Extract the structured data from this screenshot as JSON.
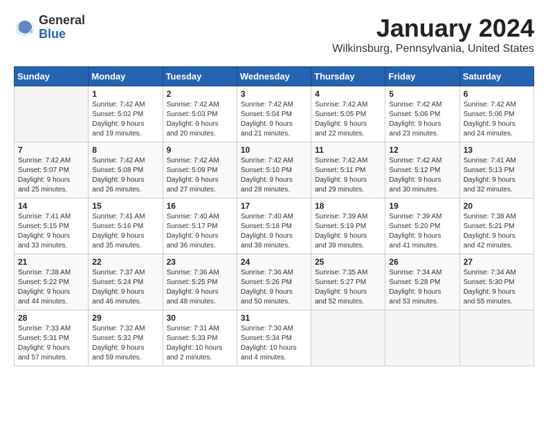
{
  "logo": {
    "general": "General",
    "blue": "Blue"
  },
  "header": {
    "month": "January 2024",
    "location": "Wilkinsburg, Pennsylvania, United States"
  },
  "weekdays": [
    "Sunday",
    "Monday",
    "Tuesday",
    "Wednesday",
    "Thursday",
    "Friday",
    "Saturday"
  ],
  "weeks": [
    [
      {
        "day": "",
        "info": ""
      },
      {
        "day": "1",
        "info": "Sunrise: 7:42 AM\nSunset: 5:02 PM\nDaylight: 9 hours\nand 19 minutes."
      },
      {
        "day": "2",
        "info": "Sunrise: 7:42 AM\nSunset: 5:03 PM\nDaylight: 9 hours\nand 20 minutes."
      },
      {
        "day": "3",
        "info": "Sunrise: 7:42 AM\nSunset: 5:04 PM\nDaylight: 9 hours\nand 21 minutes."
      },
      {
        "day": "4",
        "info": "Sunrise: 7:42 AM\nSunset: 5:05 PM\nDaylight: 9 hours\nand 22 minutes."
      },
      {
        "day": "5",
        "info": "Sunrise: 7:42 AM\nSunset: 5:06 PM\nDaylight: 9 hours\nand 23 minutes."
      },
      {
        "day": "6",
        "info": "Sunrise: 7:42 AM\nSunset: 5:06 PM\nDaylight: 9 hours\nand 24 minutes."
      }
    ],
    [
      {
        "day": "7",
        "info": "Sunrise: 7:42 AM\nSunset: 5:07 PM\nDaylight: 9 hours\nand 25 minutes."
      },
      {
        "day": "8",
        "info": "Sunrise: 7:42 AM\nSunset: 5:08 PM\nDaylight: 9 hours\nand 26 minutes."
      },
      {
        "day": "9",
        "info": "Sunrise: 7:42 AM\nSunset: 5:09 PM\nDaylight: 9 hours\nand 27 minutes."
      },
      {
        "day": "10",
        "info": "Sunrise: 7:42 AM\nSunset: 5:10 PM\nDaylight: 9 hours\nand 28 minutes."
      },
      {
        "day": "11",
        "info": "Sunrise: 7:42 AM\nSunset: 5:11 PM\nDaylight: 9 hours\nand 29 minutes."
      },
      {
        "day": "12",
        "info": "Sunrise: 7:42 AM\nSunset: 5:12 PM\nDaylight: 9 hours\nand 30 minutes."
      },
      {
        "day": "13",
        "info": "Sunrise: 7:41 AM\nSunset: 5:13 PM\nDaylight: 9 hours\nand 32 minutes."
      }
    ],
    [
      {
        "day": "14",
        "info": "Sunrise: 7:41 AM\nSunset: 5:15 PM\nDaylight: 9 hours\nand 33 minutes."
      },
      {
        "day": "15",
        "info": "Sunrise: 7:41 AM\nSunset: 5:16 PM\nDaylight: 9 hours\nand 35 minutes."
      },
      {
        "day": "16",
        "info": "Sunrise: 7:40 AM\nSunset: 5:17 PM\nDaylight: 9 hours\nand 36 minutes."
      },
      {
        "day": "17",
        "info": "Sunrise: 7:40 AM\nSunset: 5:18 PM\nDaylight: 9 hours\nand 38 minutes."
      },
      {
        "day": "18",
        "info": "Sunrise: 7:39 AM\nSunset: 5:19 PM\nDaylight: 9 hours\nand 39 minutes."
      },
      {
        "day": "19",
        "info": "Sunrise: 7:39 AM\nSunset: 5:20 PM\nDaylight: 9 hours\nand 41 minutes."
      },
      {
        "day": "20",
        "info": "Sunrise: 7:38 AM\nSunset: 5:21 PM\nDaylight: 9 hours\nand 42 minutes."
      }
    ],
    [
      {
        "day": "21",
        "info": "Sunrise: 7:38 AM\nSunset: 5:22 PM\nDaylight: 9 hours\nand 44 minutes."
      },
      {
        "day": "22",
        "info": "Sunrise: 7:37 AM\nSunset: 5:24 PM\nDaylight: 9 hours\nand 46 minutes."
      },
      {
        "day": "23",
        "info": "Sunrise: 7:36 AM\nSunset: 5:25 PM\nDaylight: 9 hours\nand 48 minutes."
      },
      {
        "day": "24",
        "info": "Sunrise: 7:36 AM\nSunset: 5:26 PM\nDaylight: 9 hours\nand 50 minutes."
      },
      {
        "day": "25",
        "info": "Sunrise: 7:35 AM\nSunset: 5:27 PM\nDaylight: 9 hours\nand 52 minutes."
      },
      {
        "day": "26",
        "info": "Sunrise: 7:34 AM\nSunset: 5:28 PM\nDaylight: 9 hours\nand 53 minutes."
      },
      {
        "day": "27",
        "info": "Sunrise: 7:34 AM\nSunset: 5:30 PM\nDaylight: 9 hours\nand 55 minutes."
      }
    ],
    [
      {
        "day": "28",
        "info": "Sunrise: 7:33 AM\nSunset: 5:31 PM\nDaylight: 9 hours\nand 57 minutes."
      },
      {
        "day": "29",
        "info": "Sunrise: 7:32 AM\nSunset: 5:32 PM\nDaylight: 9 hours\nand 59 minutes."
      },
      {
        "day": "30",
        "info": "Sunrise: 7:31 AM\nSunset: 5:33 PM\nDaylight: 10 hours\nand 2 minutes."
      },
      {
        "day": "31",
        "info": "Sunrise: 7:30 AM\nSunset: 5:34 PM\nDaylight: 10 hours\nand 4 minutes."
      },
      {
        "day": "",
        "info": ""
      },
      {
        "day": "",
        "info": ""
      },
      {
        "day": "",
        "info": ""
      }
    ]
  ]
}
